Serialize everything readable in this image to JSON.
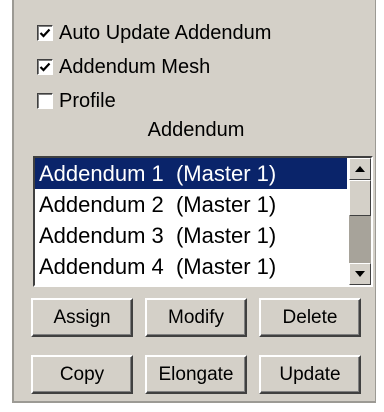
{
  "checkboxes": [
    {
      "label": "Auto Update Addendum",
      "checked": true
    },
    {
      "label": "Addendum Mesh",
      "checked": true
    },
    {
      "label": "Profile",
      "checked": false
    }
  ],
  "section_title": "Addendum",
  "list": {
    "items": [
      "Addendum 1  (Master 1)",
      "Addendum 2  (Master 1)",
      "Addendum 3  (Master 1)",
      "Addendum 4  (Master 1)"
    ],
    "selected_index": 0
  },
  "buttons": {
    "assign": "Assign",
    "modify": "Modify",
    "delete": "Delete",
    "copy": "Copy",
    "elongate": "Elongate",
    "update": "Update"
  },
  "colors": {
    "panel": "#d4d0c8",
    "selection": "#0a246a"
  },
  "icons": {
    "scroll_up": "triangle-up-icon",
    "scroll_down": "triangle-down-icon",
    "check": "check-mark-icon"
  }
}
